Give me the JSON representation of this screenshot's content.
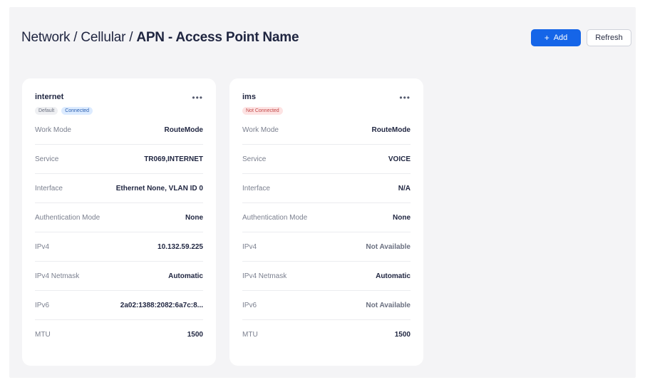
{
  "breadcrumb": {
    "part1": "Network",
    "sep": "/",
    "part2": "Cellular",
    "current": "APN - Access Point Name"
  },
  "actions": {
    "add_label": "Add",
    "add_icon": "+",
    "refresh_label": "Refresh"
  },
  "cards": [
    {
      "name": "internet",
      "badges": [
        {
          "text": "Default",
          "kind": "default"
        },
        {
          "text": "Connected",
          "kind": "connected"
        }
      ],
      "rows": [
        {
          "label": "Work Mode",
          "value": "RouteMode",
          "muted": false
        },
        {
          "label": "Service",
          "value": "TR069,INTERNET",
          "muted": false
        },
        {
          "label": "Interface",
          "value": "Ethernet None, VLAN ID 0",
          "muted": false
        },
        {
          "label": "Authentication Mode",
          "value": "None",
          "muted": false
        },
        {
          "label": "IPv4",
          "value": "10.132.59.225",
          "muted": false
        },
        {
          "label": "IPv4 Netmask",
          "value": "Automatic",
          "muted": false
        },
        {
          "label": "IPv6",
          "value": "2a02:1388:2082:6a7c:8...",
          "muted": false
        },
        {
          "label": "MTU",
          "value": "1500",
          "muted": false
        }
      ]
    },
    {
      "name": "ims",
      "badges": [
        {
          "text": "Not Connected",
          "kind": "notconnected"
        }
      ],
      "rows": [
        {
          "label": "Work Mode",
          "value": "RouteMode",
          "muted": false
        },
        {
          "label": "Service",
          "value": "VOICE",
          "muted": false
        },
        {
          "label": "Interface",
          "value": "N/A",
          "muted": false
        },
        {
          "label": "Authentication Mode",
          "value": "None",
          "muted": false
        },
        {
          "label": "IPv4",
          "value": "Not Available",
          "muted": true
        },
        {
          "label": "IPv4 Netmask",
          "value": "Automatic",
          "muted": false
        },
        {
          "label": "IPv6",
          "value": "Not Available",
          "muted": true
        },
        {
          "label": "MTU",
          "value": "1500",
          "muted": false
        }
      ]
    }
  ],
  "colors": {
    "accent": "#1565e8",
    "panel_bg": "#f4f4f6",
    "text": "#1f2540"
  },
  "icons": {
    "more": "more-horizontal-icon",
    "add": "plus-icon"
  }
}
